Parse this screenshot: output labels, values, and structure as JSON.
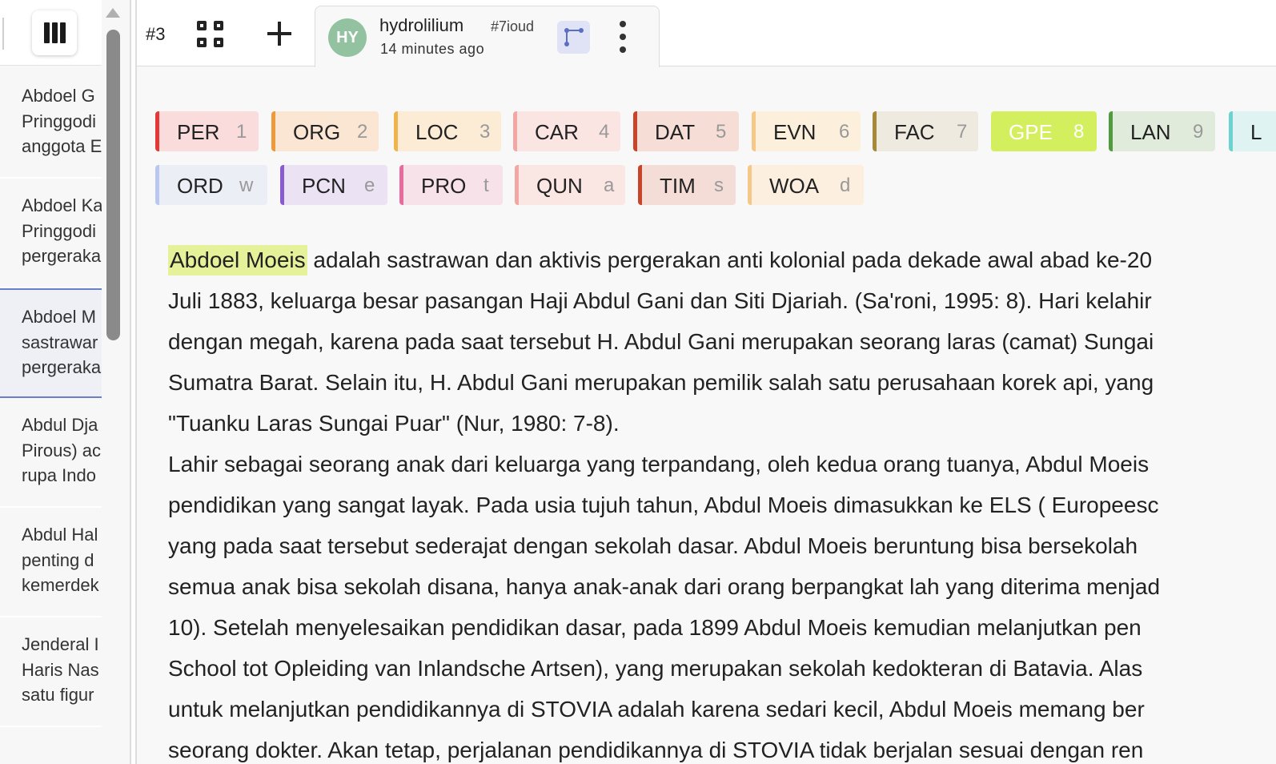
{
  "sidebar": {
    "documents": [
      {
        "lines": [
          "Abdoel G",
          "Pringgodi",
          "anggota E"
        ]
      },
      {
        "lines": [
          "Abdoel Ka",
          "Pringgodi",
          "pergeraka"
        ]
      },
      {
        "lines": [
          "Abdoel M",
          "sastrawar",
          "pergeraka"
        ],
        "active": true
      },
      {
        "lines": [
          "Abdul Dja",
          "Pirous) ac",
          "rupa Indo"
        ]
      },
      {
        "lines": [
          "Abdul Hal",
          "penting d",
          "kemerdek"
        ]
      },
      {
        "lines": [
          "Jenderal I",
          "Haris Nas",
          "satu figur"
        ]
      }
    ],
    "columns_icon": "view-columns-icon"
  },
  "tabbar": {
    "tab_count": "#3",
    "grid_icon": "grid-view-icon",
    "add_icon": "plus-icon",
    "tab": {
      "avatar": "HY",
      "user": "hydrolilium",
      "id": "#7ioud",
      "time": "14 minutes ago",
      "relation_icon": "relation-graph-icon",
      "menu_icon": "more-vertical-icon"
    }
  },
  "labels": {
    "row1": [
      {
        "name": "PER",
        "key": "1",
        "color": "#e53935",
        "bg": "#f9dcdb"
      },
      {
        "name": "ORG",
        "key": "2",
        "color": "#ef9a3a",
        "bg": "#fbe6d4"
      },
      {
        "name": "LOC",
        "key": "3",
        "color": "#f0b44c",
        "bg": "#fcecd6"
      },
      {
        "name": "CAR",
        "key": "4",
        "color": "#f2a7a4",
        "bg": "#fbe5e3"
      },
      {
        "name": "DAT",
        "key": "5",
        "color": "#c8452a",
        "bg": "#f6ded6"
      },
      {
        "name": "EVN",
        "key": "6",
        "color": "#f5c887",
        "bg": "#fcefdc"
      },
      {
        "name": "FAC",
        "key": "7",
        "color": "#a68a3a",
        "bg": "#eeeadf"
      },
      {
        "name": "GPE",
        "key": "8",
        "color": "#d2ee5a",
        "bg": "#d4ef5e",
        "selected": true
      },
      {
        "name": "LAN",
        "key": "9",
        "color": "#4f9b3d",
        "bg": "#e1ebdc"
      },
      {
        "name": "L",
        "key": "",
        "color": "#6ed3d0",
        "bg": "#def3f2"
      }
    ],
    "row2": [
      {
        "name": "ORD",
        "key": "w",
        "color": "#b8c8f0",
        "bg": "#eceef5"
      },
      {
        "name": "PCN",
        "key": "e",
        "color": "#8a5ad1",
        "bg": "#ebe2f3"
      },
      {
        "name": "PRO",
        "key": "t",
        "color": "#e96b9c",
        "bg": "#f8e2ea"
      },
      {
        "name": "QUN",
        "key": "a",
        "color": "#f2a7a4",
        "bg": "#fae6e3"
      },
      {
        "name": "TIM",
        "key": "s",
        "color": "#c8452a",
        "bg": "#f4ddd7"
      },
      {
        "name": "WOA",
        "key": "d",
        "color": "#f5c887",
        "bg": "#fcefdf"
      }
    ]
  },
  "content": {
    "entity": "Abdoel Moeis",
    "first_line_rest": " adalah sastrawan dan aktivis pergerakan anti kolonial pada dekade awal abad ke-20",
    "lines": [
      "Juli 1883, keluarga besar pasangan Haji Abdul Gani dan Siti Djariah. (Sa'roni, 1995: 8). Hari kelahir",
      "dengan megah, karena pada saat tersebut H. Abdul Gani merupakan seorang laras (camat) Sungai",
      "Sumatra Barat. Selain itu, H. Abdul Gani merupakan pemilik salah satu perusahaan korek api, yang",
      "\"Tuanku Laras Sungai Puar\" (Nur, 1980: 7-8).",
      "Lahir sebagai seorang anak dari keluarga yang terpandang, oleh kedua orang tuanya, Abdul Moeis",
      "pendidikan yang sangat layak. Pada usia tujuh tahun, Abdul Moeis dimasukkan ke ELS ( Europeesc",
      "yang pada saat tersebut sederajat dengan sekolah dasar. Abdul Moeis beruntung bisa bersekolah",
      "semua anak bisa sekolah disana, hanya anak-anak dari orang berpangkat lah yang diterima menjad",
      "10). Setelah menyelesaikan pendidikan dasar, pada 1899 Abdul Moeis kemudian melanjutkan pen",
      "School tot Opleiding van Inlandsche Artsen), yang merupakan sekolah kedokteran di Batavia. Alas",
      "untuk melanjutkan pendidikannya di STOVIA adalah karena sedari kecil, Abdul Moeis memang ber",
      "seorang dokter. Akan tetap, perjalanan pendidikannya di STOVIA tidak berjalan sesuai dengan ren"
    ]
  }
}
